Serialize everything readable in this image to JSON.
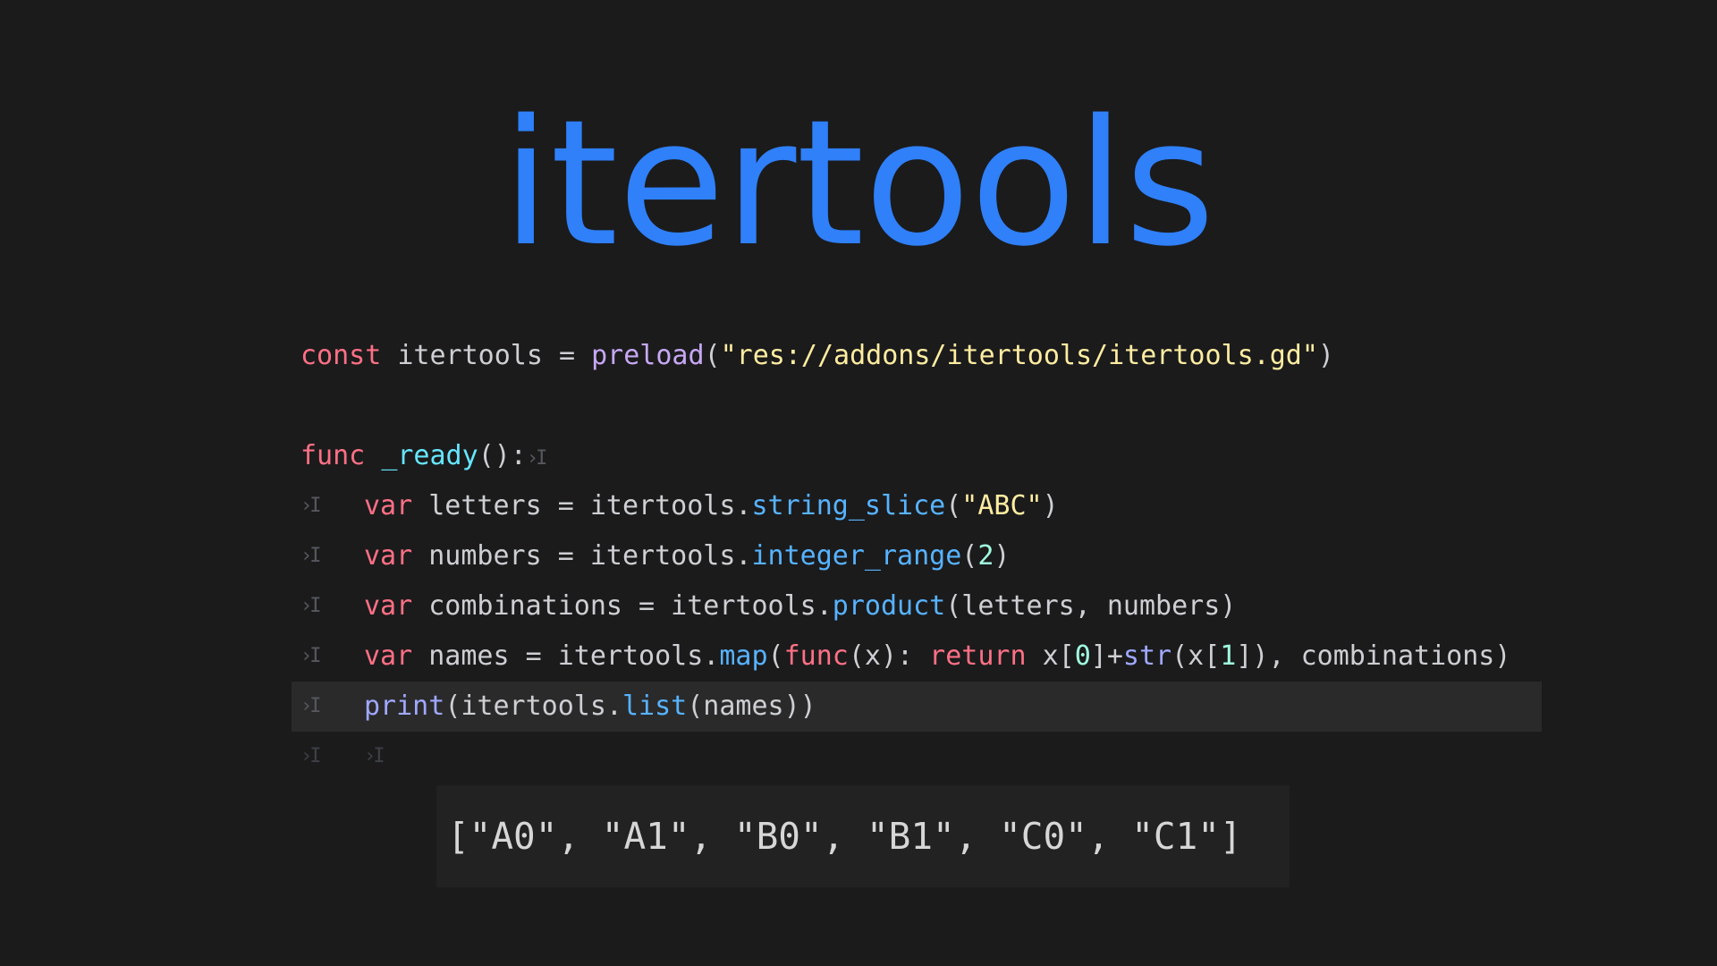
{
  "title": "itertools",
  "code": {
    "line1": {
      "t1": "const",
      "t2": " itertools = ",
      "t3": "preload",
      "t4": "(",
      "t5": "\"res://addons/itertools/itertools.gd\"",
      "t6": ")"
    },
    "line2": {
      "t1": "func",
      "t2": " ",
      "t3": "_ready",
      "t4": "():"
    },
    "line3": {
      "t1": "var",
      "t2": " letters = itertools.",
      "t3": "string_slice",
      "t4": "(",
      "t5": "\"ABC\"",
      "t6": ")"
    },
    "line4": {
      "t1": "var",
      "t2": " numbers = itertools.",
      "t3": "integer_range",
      "t4": "(",
      "t5": "2",
      "t6": ")"
    },
    "line5": {
      "t1": "var",
      "t2": " combinations = itertools.",
      "t3": "product",
      "t4": "(letters, numbers)"
    },
    "line6": {
      "t1": "var",
      "t2": " names = itertools.",
      "t3": "map",
      "t4": "(",
      "t5": "func",
      "t6": "(x): ",
      "t7": "return",
      "t8": " x[",
      "t9": "0",
      "t10": "]+",
      "t11": "str",
      "t12": "(x[",
      "t13": "1",
      "t14": "]), combinations)"
    },
    "line7": {
      "t1": "print",
      "t2": "(itertools.",
      "t3": "list",
      "t4": "(names))"
    },
    "tab_marker": "›I"
  },
  "output": "[\"A0\", \"A1\", \"B0\", \"B1\", \"C0\", \"C1\"]",
  "colors": {
    "background": "#1b1b1c",
    "title": "#2f80f9",
    "keyword": "#ff7085",
    "string": "#ffeda1",
    "number": "#a1ffe0",
    "method": "#57b3ff",
    "builtin": "#9fa8ff",
    "current_line": "#2a2a2b"
  },
  "icons": {
    "tab_marker": "tab-indent-icon"
  }
}
